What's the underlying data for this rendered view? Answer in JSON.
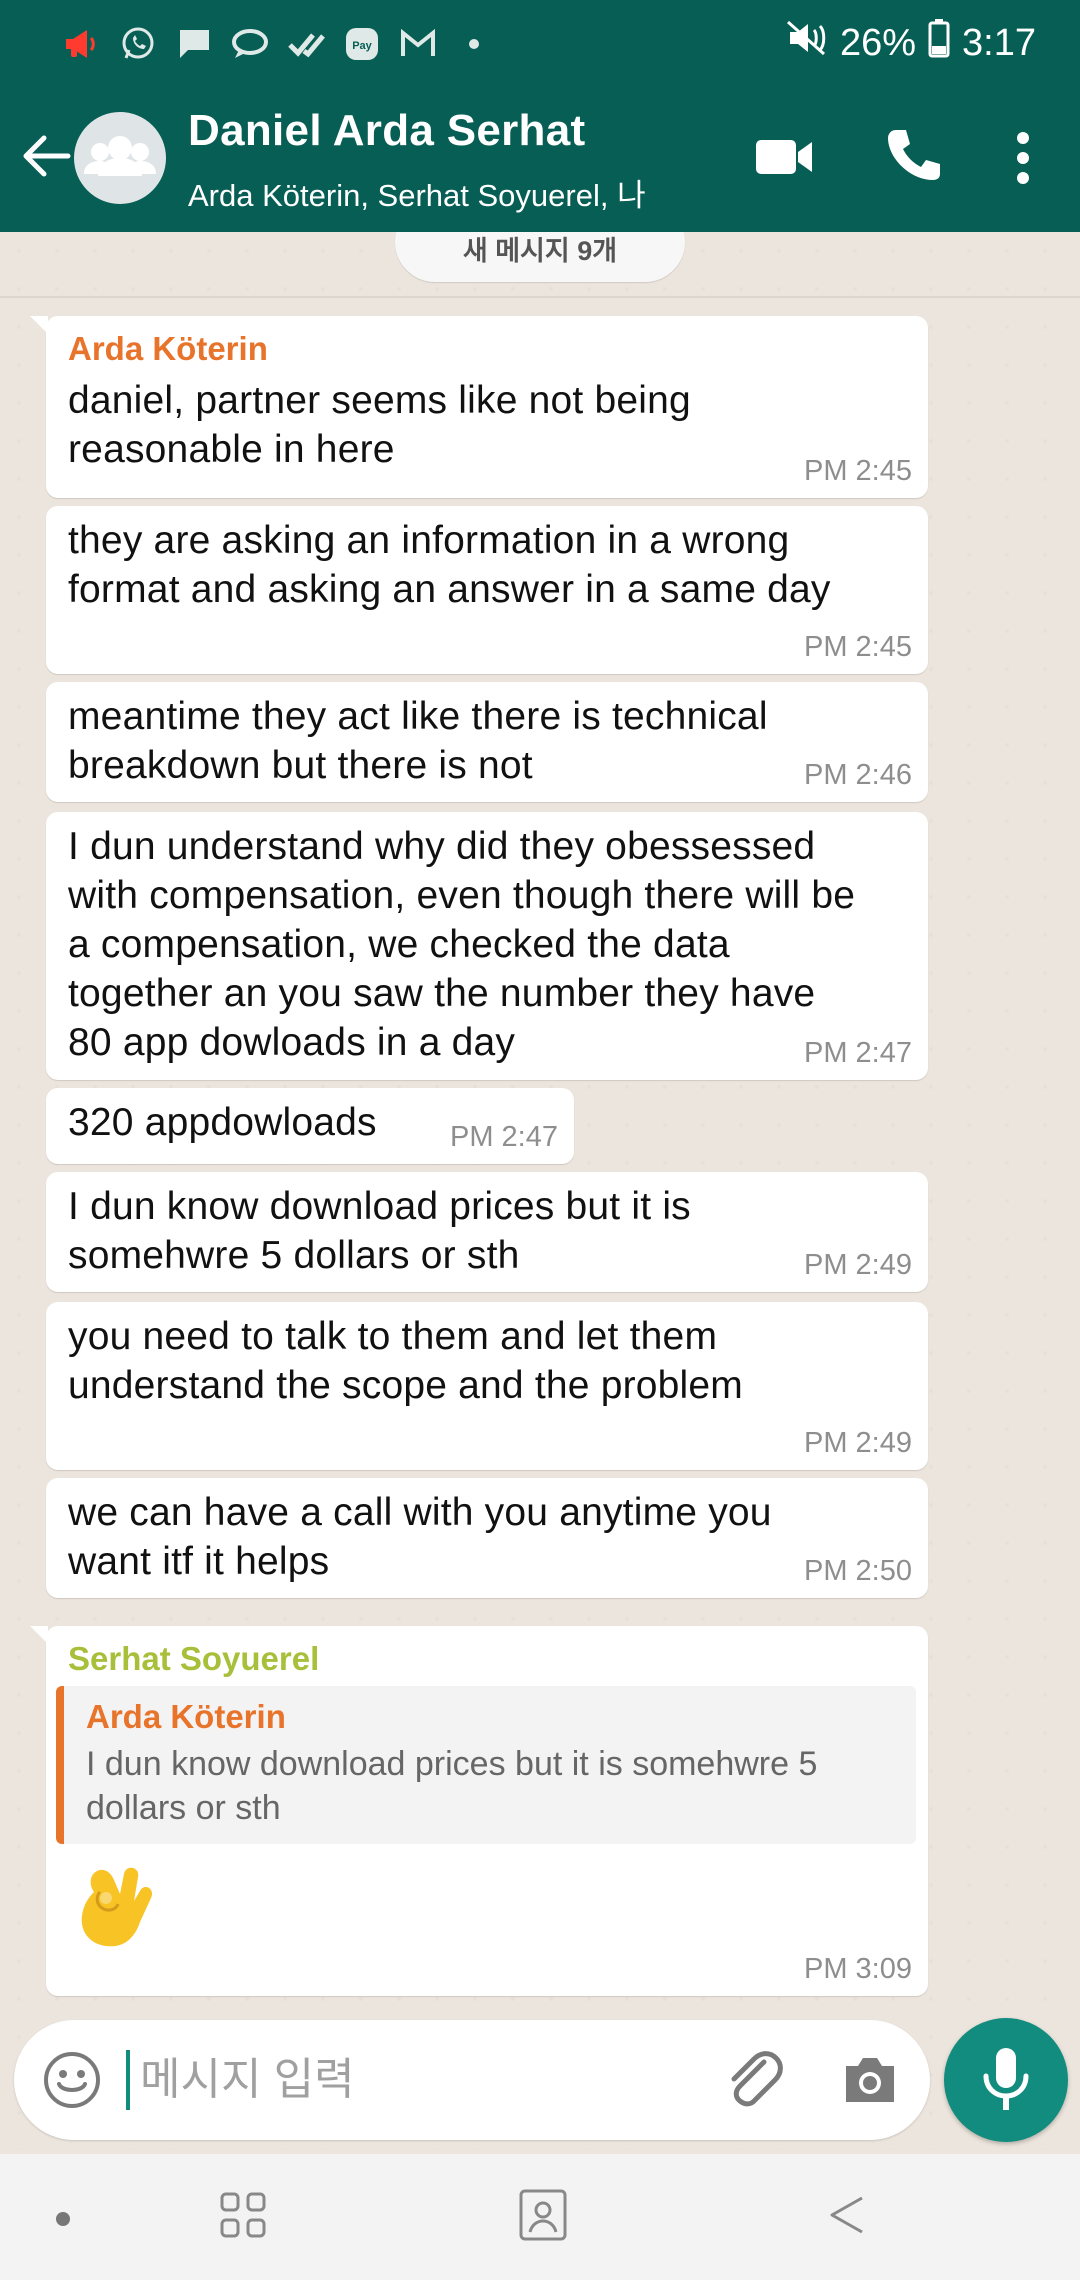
{
  "status_bar": {
    "battery": "26%",
    "time": "3:17",
    "notification_icons": [
      "megaphone-icon",
      "whatsapp-icon",
      "message-icon",
      "bubble-icon",
      "double-check-icon",
      "pay-icon",
      "gmail-icon",
      "more-dot-icon"
    ],
    "system_icons": [
      "mute-icon",
      "battery-icon"
    ]
  },
  "header": {
    "title": "Daniel Arda Serhat",
    "subtitle": "Arda Köterin, Serhat Soyuerel, 나",
    "icons": [
      "back-arrow-icon",
      "group-avatar-icon",
      "video-call-icon",
      "voice-call-icon",
      "more-vert-icon"
    ]
  },
  "chat": {
    "unread_banner": "새 메시지 9개",
    "messages": [
      {
        "sender": "Arda Köterin",
        "text": "daniel, partner seems like not being\nreasonable in here",
        "time": "PM 2:45"
      },
      {
        "text": "they are asking an information in a wrong\nformat and asking an answer in a same day",
        "time": "PM 2:45"
      },
      {
        "text": "meantime they act like there is technical\nbreakdown but there is not",
        "time": "PM 2:46"
      },
      {
        "text": "I dun understand why did they obessessed\nwith compensation, even though there will be\na compensation, we checked the data\ntogether an you saw the number they have\n80 app dowloads in a day",
        "time": "PM 2:47"
      },
      {
        "text": "320 appdowloads",
        "time": "PM 2:47"
      },
      {
        "text": "I dun know download prices but it is\nsomehwre 5 dollars or sth",
        "time": "PM 2:49"
      },
      {
        "text": "you need to talk to them and let them\nunderstand the scope and the problem",
        "time": "PM 2:49"
      },
      {
        "text": "we can have a call with you anytime you\nwant itf it helps",
        "time": "PM 2:50"
      }
    ],
    "reply": {
      "sender": "Serhat Soyuerel",
      "quoted_sender": "Arda Köterin",
      "quoted_text": "I dun know download prices but it is somehwre 5\ndollars or sth",
      "emoji": "ok-hand-emoji",
      "time": "PM 3:09"
    }
  },
  "composer": {
    "placeholder": "메시지 입력",
    "icons": [
      "emoji-icon",
      "attach-icon",
      "camera-icon",
      "mic-icon"
    ]
  },
  "nav_bar": {
    "icons": [
      "nav-dot-icon",
      "recent-apps-icon",
      "home-icon",
      "back-icon"
    ]
  },
  "colors": {
    "header": "#075e54",
    "accent": "#128c7e",
    "sender_arda": "#e8742b",
    "sender_serhat": "#a8bf3a",
    "chat_bg": "#ece5dd"
  }
}
